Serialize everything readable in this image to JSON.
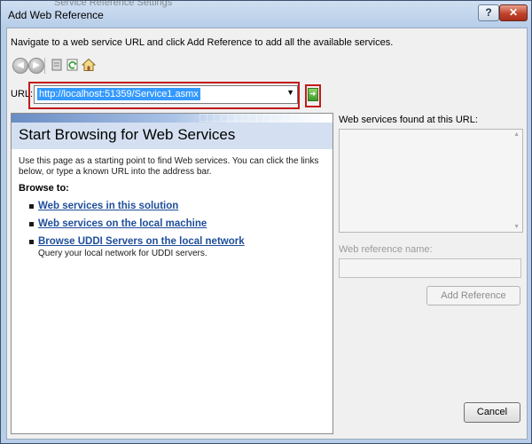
{
  "window": {
    "title": "Add Web Reference",
    "behind_title": "Service Reference Settings"
  },
  "instruction": "Navigate to a web service URL and click Add Reference to add all the available services.",
  "toolbar": {
    "icons": [
      "back-arrow-icon",
      "forward-arrow-icon",
      "stop-icon",
      "refresh-icon",
      "home-icon"
    ]
  },
  "url": {
    "label": "URL:",
    "value": "http://localhost:51359/Service1.asmx"
  },
  "browser": {
    "heading": "Start Browsing for Web Services",
    "description": "Use this page as a starting point to find Web services. You can click the links below, or type a known URL into the address bar.",
    "browse_to": "Browse to:",
    "links": [
      {
        "label": "Web services in this solution"
      },
      {
        "label": "Web services on the local machine"
      },
      {
        "label": "Browse UDDI Servers on the local network",
        "sublabel": "Query your local network for UDDI servers."
      }
    ]
  },
  "right_panel": {
    "services_found_label": "Web services found at this URL:",
    "web_reference_name_label": "Web reference name:",
    "add_reference_button": "Add Reference"
  },
  "footer": {
    "cancel_button": "Cancel"
  },
  "colors": {
    "highlight": "#c41a1a",
    "link": "#1f4e9a",
    "selection": "#3399ff"
  }
}
